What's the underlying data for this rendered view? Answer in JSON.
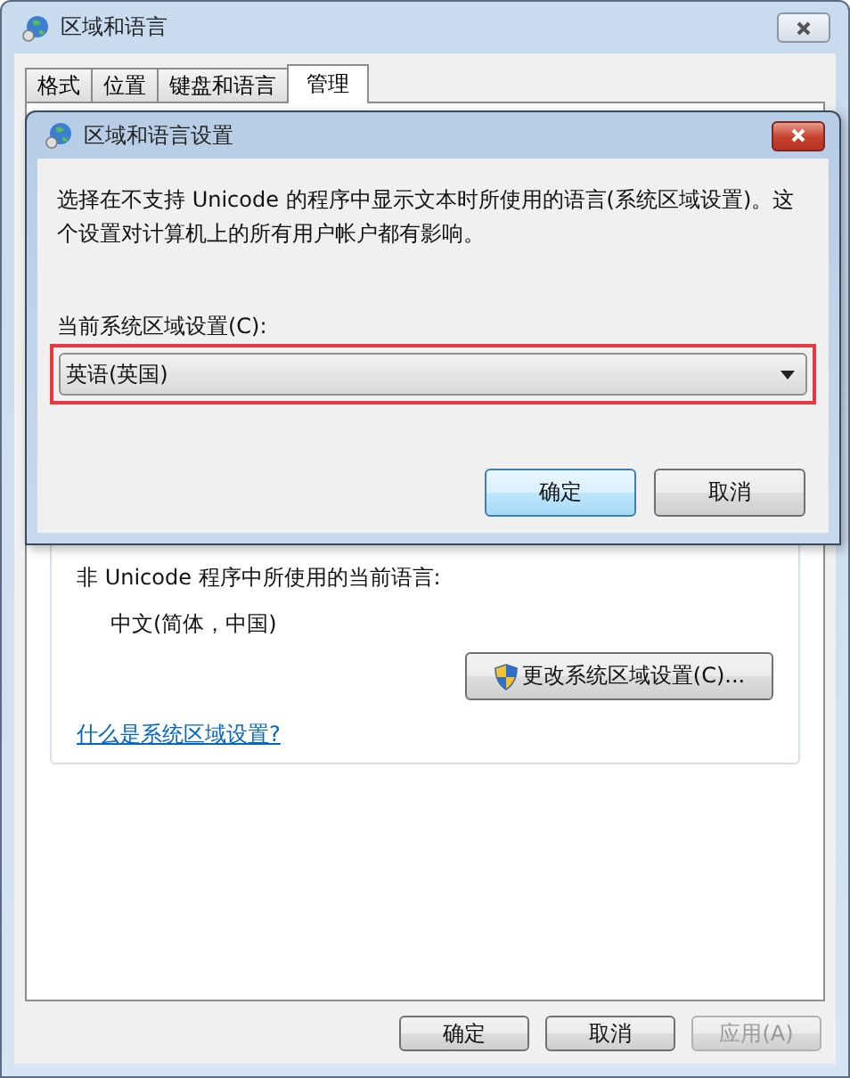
{
  "window": {
    "title": "区域和语言"
  },
  "tabs": [
    {
      "label": "格式",
      "selected": false
    },
    {
      "label": "位置",
      "selected": false
    },
    {
      "label": "键盘和语言",
      "selected": false
    },
    {
      "label": "管理",
      "selected": true
    }
  ],
  "panel": {
    "language_label": "非 Unicode 程序中所使用的当前语言:",
    "current_language": "中文(简体，中国)",
    "change_button": "更改系统区域设置(C)...",
    "help_link": "什么是系统区域设置?"
  },
  "buttons": [
    {
      "label": "确定",
      "disabled": false
    },
    {
      "label": "取消",
      "disabled": false
    },
    {
      "label": "应用(A)",
      "disabled": true
    }
  ],
  "dialog": {
    "title": "区域和语言设置",
    "description": "选择在不支持 Unicode 的程序中显示文本时所使用的语言(系统区域设置)。这个设置对计算机上的所有用户帐户都有影响。",
    "locale_label": "当前系统区域设置(C):",
    "locale_select": {
      "value": "英语(英国)",
      "highlighted": true
    },
    "buttons": [
      {
        "label": "确定",
        "default": true
      },
      {
        "label": "取消",
        "default": false
      }
    ]
  }
}
